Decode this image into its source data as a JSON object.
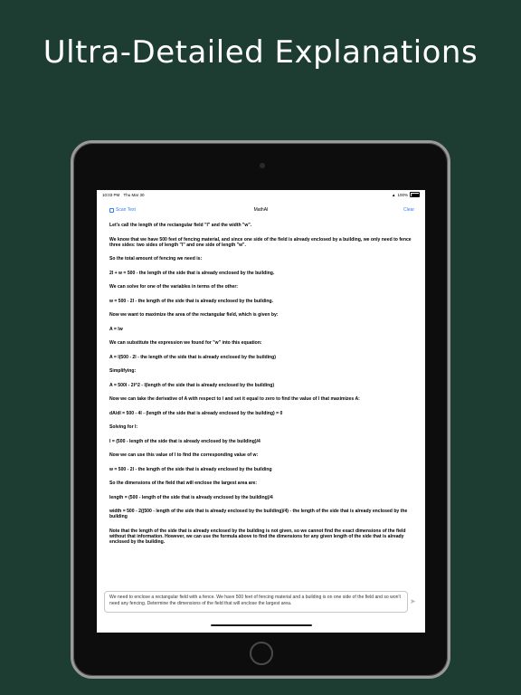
{
  "headline": "Ultra-Detailed Explanations",
  "status": {
    "time": "10:03 PM",
    "date": "Thu Mar 30",
    "battery": "100%"
  },
  "navbar": {
    "scan_label": "Scan Text",
    "title": "MathAI",
    "clear_label": "Clear"
  },
  "explanation": [
    "Let's call the length of the rectangular field \"l\" and the width \"w\".",
    "We know that we have 500 feet of fencing material, and since one side of the field is already enclosed by a building, we only need to fence three sides: two sides of length \"l\" and one side of length \"w\".",
    "So the total amount of fencing we need is:",
    "2l + w = 500 - the length of the side that is already enclosed by the building.",
    "We can solve for one of the variables in terms of the other:",
    "w = 500 - 2l - the length of the side that is already enclosed by the building.",
    "Now we want to maximize the area of the rectangular field, which is given by:",
    "A = lw",
    "We can substitute the expression we found for \"w\" into this equation:",
    "A = l(500 - 2l - the length of the side that is already enclosed by the building)",
    "Simplifying:",
    "A = 500l - 2l^2 - l(length of the side that is already enclosed by the building)",
    "Now we can take the derivative of A with respect to l and set it equal to zero to find the value of l that maximizes A:",
    "dA/dl = 500 - 4l - (length of the side that is already enclosed by the building) = 0",
    "Solving for l:",
    "l = (500 - length of the side that is already enclosed by the building)/4",
    "Now we can use this value of l to find the corresponding value of w:",
    "w = 500 - 2l - the length of the side that is already enclosed by the building",
    "So the dimensions of the field that will enclose the largest area are:",
    "length = (500 - length of the side that is already enclosed by the building)/4",
    "width = 500 - 2((500 - length of the side that is already enclosed by the building)/4) - the length of the side that is already enclosed by the building",
    "Note that the length of the side that is already enclosed by the building is not given, so we cannot find the exact dimensions of the field without that information. However, we can use the formula above to find the dimensions for any given length of the side that is already enclosed by the building."
  ],
  "input": {
    "value": "We need to enclose a rectangular field with a fence. We have 500 feet of fencing material and a building is on one side of the field and so won't need any fencing. Determine the dimensions of the field that will enclose the largest area."
  }
}
